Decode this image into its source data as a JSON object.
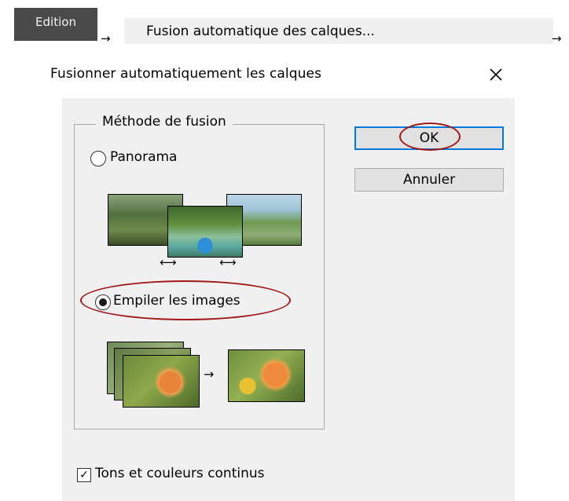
{
  "steps": {
    "menu_label": "Edition",
    "arrow": "→",
    "command_label": "Fusion automatique des calques..."
  },
  "dialog": {
    "title": "Fusionner automatiquement les calques",
    "close_glyph": "✕",
    "method_group": {
      "legend": "Méthode de fusion",
      "options": [
        {
          "label": "Panorama",
          "selected": false
        },
        {
          "label": "Empiler les images",
          "selected": true
        }
      ],
      "size_arrow": "⟷",
      "stack_arrow": "→"
    },
    "buttons": {
      "ok": "OK",
      "cancel": "Annuler"
    },
    "checkbox": {
      "label": "Tons et couleurs continus",
      "checked": true,
      "glyph": "✓"
    }
  },
  "colors": {
    "highlight": "#a01818",
    "dialog_bg": "#f0f0f0",
    "menu_bg": "#4a4a4a",
    "accent": "#0078d7"
  }
}
